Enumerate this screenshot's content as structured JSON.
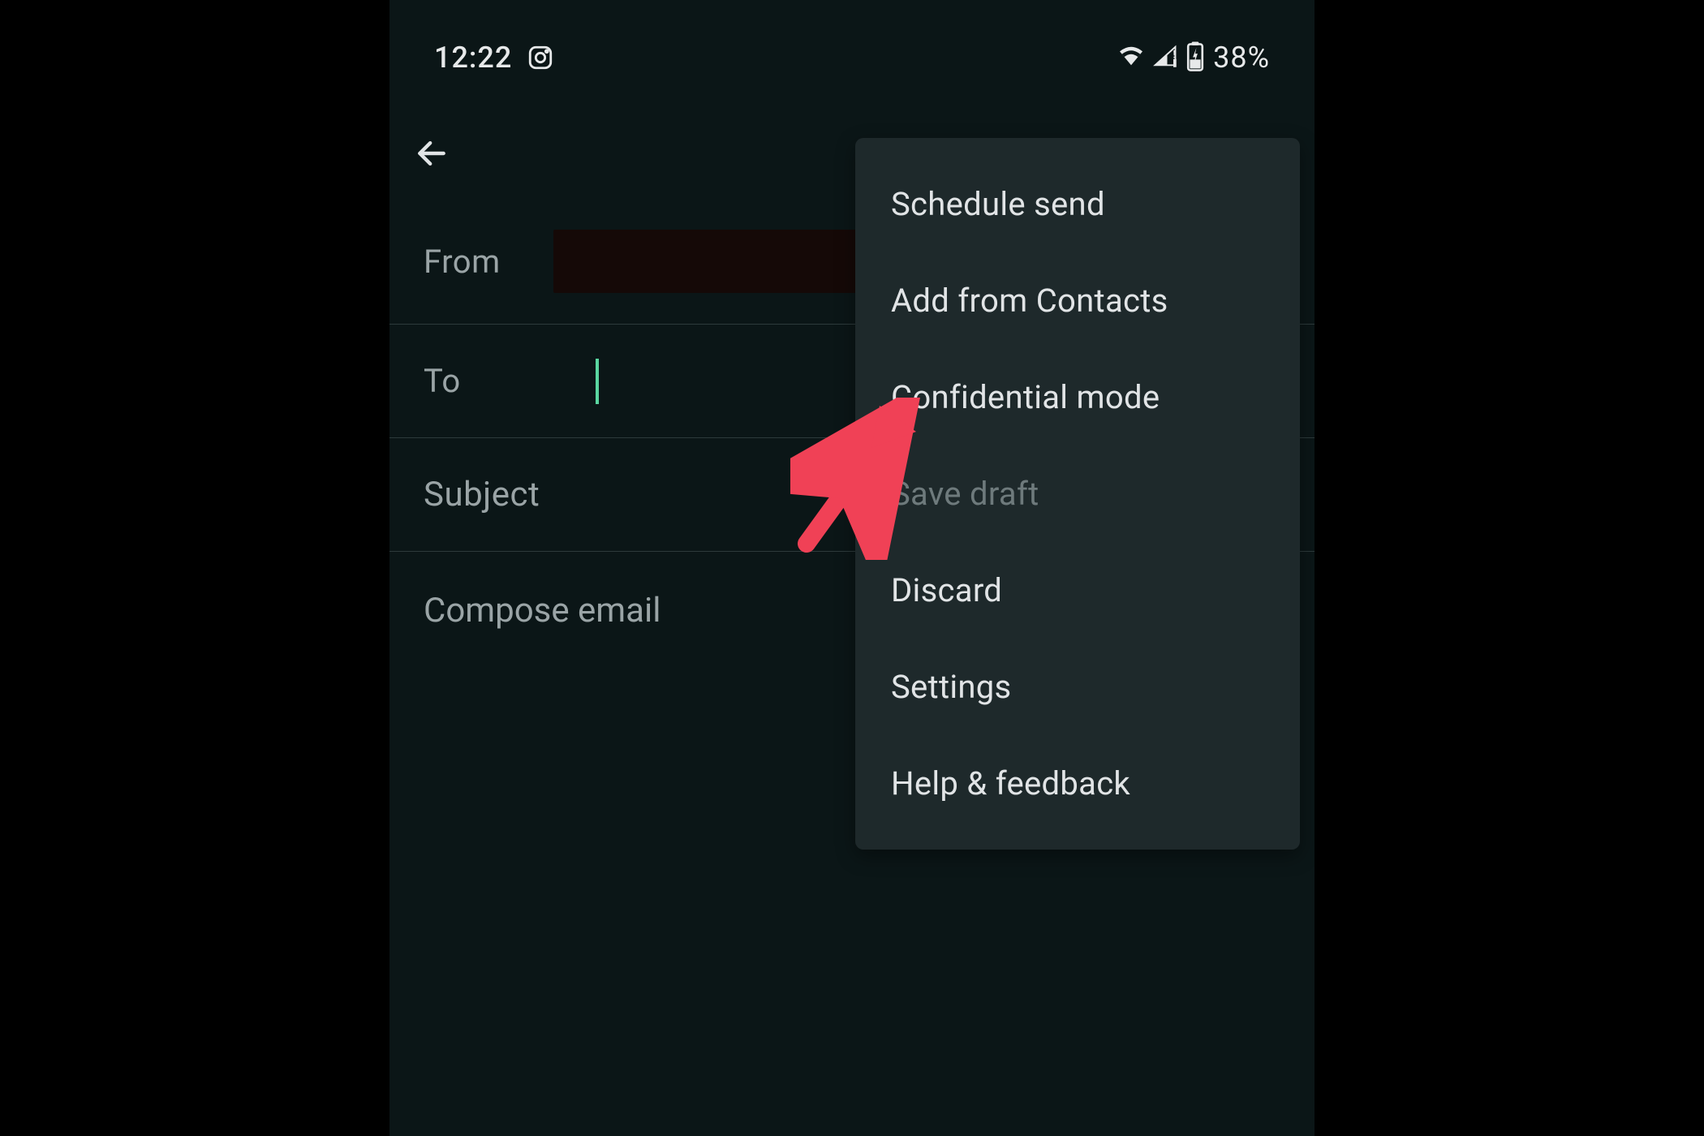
{
  "status": {
    "time": "12:22",
    "battery": "38%"
  },
  "compose": {
    "from_label": "From",
    "to_label": "To",
    "subject_label": "Subject",
    "body_placeholder": "Compose email"
  },
  "menu": {
    "items": [
      {
        "label": "Schedule send",
        "disabled": false
      },
      {
        "label": "Add from Contacts",
        "disabled": false
      },
      {
        "label": "Confidential mode",
        "disabled": false
      },
      {
        "label": "Save draft",
        "disabled": true
      },
      {
        "label": "Discard",
        "disabled": false
      },
      {
        "label": "Settings",
        "disabled": false
      },
      {
        "label": "Help & feedback",
        "disabled": false
      }
    ]
  },
  "colors": {
    "accent_cursor": "#5ad6a0",
    "menu_bg": "#1e292b",
    "screen_bg": "#0b1617",
    "label_text": "#9aa4a6",
    "arrow": "#f04156"
  }
}
